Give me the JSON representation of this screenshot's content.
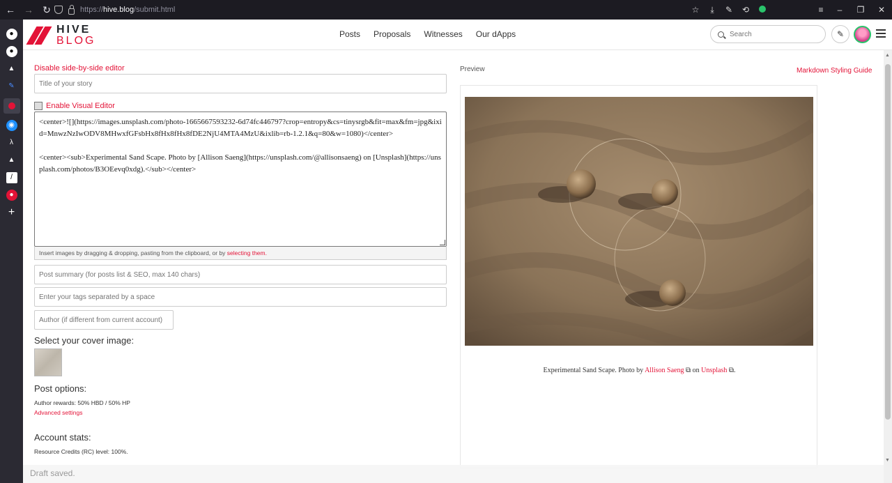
{
  "browser": {
    "url_proto": "https://",
    "url_host": "hive.blog",
    "url_path": "/submit.html"
  },
  "header": {
    "logo_line1": "HIVE",
    "logo_line2": "BLOG",
    "nav": [
      "Posts",
      "Proposals",
      "Witnesses",
      "Our dApps"
    ],
    "search_placeholder": "Search"
  },
  "editor": {
    "disable_link": "Disable side-by-side editor",
    "title_placeholder": "Title of your story",
    "visual_editor_label": "Enable Visual Editor",
    "body": "<center>![](https://images.unsplash.com/photo-1665667593232-6d74fc446797?crop=entropy&cs=tinysrgb&fit=max&fm=jpg&ixid=MnwzNzIwODV8MHwxfGFsbHx8fHx8fHx8fDE2NjU4MTA4MzU&ixlib=rb-1.2.1&q=80&w=1080)</center>\n\n<center><sub>Experimental Sand Scape. Photo by [Allison Saeng](https://unsplash.com/@allisonsaeng) on [Unsplash](https://unsplash.com/photos/B3OEevq0xdg).</sub></center>",
    "drop_hint": "Insert images by dragging & dropping, pasting from the clipboard, or by ",
    "drop_hint_link": "selecting them.",
    "summary_placeholder": "Post summary (for posts list & SEO, max 140 chars)",
    "tags_placeholder": "Enter your tags separated by a space",
    "author_placeholder": "Author (if different from current account)",
    "cover_heading": "Select your cover image:",
    "options_heading": "Post options:",
    "rewards_text": "Author rewards: 50% HBD / 50% HP",
    "advanced_link": "Advanced settings",
    "stats_heading": "Account stats:",
    "rc_text": "Resource Credits (RC) level: 100%.",
    "draft_status": "Draft saved."
  },
  "preview": {
    "label": "Preview",
    "guide_link": "Markdown Styling Guide",
    "caption_prefix": "Experimental Sand Scape. Photo by ",
    "caption_author": "Allison Saeng",
    "caption_mid": " on ",
    "caption_site": "Unsplash",
    "caption_suffix": "."
  },
  "colors": {
    "accent": "#e31337",
    "browser_bg": "#1c1b22",
    "sidebar_bg": "#2b2a33"
  }
}
